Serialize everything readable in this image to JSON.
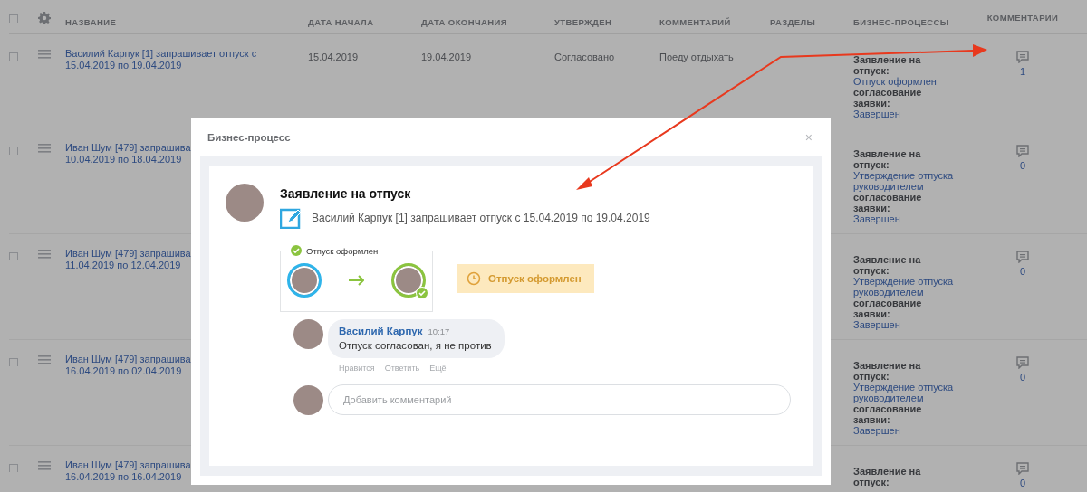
{
  "table": {
    "header_checkbox": {
      "checked": false
    },
    "columns": [
      "НАЗВАНИЕ",
      "ДАТА НАЧАЛА",
      "ДАТА ОКОНЧАНИЯ",
      "УТВЕРЖДЕН",
      "КОММЕНТАРИЙ",
      "РАЗДЕЛЫ",
      "БИЗНЕС-ПРОЦЕССЫ",
      "КОММЕНТАРИИ"
    ],
    "rows": [
      {
        "checked": false,
        "title_lines": [
          "Василий Карпук [1] запрашивает отпуск с",
          "15.04.2019 по 19.04.2019"
        ],
        "start_date": "15.04.2019",
        "end_date": "19.04.2019",
        "approved": "Согласовано",
        "comment": "Поеду отдыхать",
        "processes": [
          {
            "label": "Заявление на отпуск:",
            "status": "Отпуск оформлен"
          },
          {
            "label": "согласование заявки:",
            "status": "Завершен"
          }
        ],
        "comment_count": "1"
      },
      {
        "checked": false,
        "title_lines": [
          "Иван Шум [479] запрашива",
          "10.04.2019 по 18.04.2019"
        ],
        "processes": [
          {
            "label": "Заявление на отпуск:",
            "status": "Утверждение отпуска руководителем"
          },
          {
            "label": "согласование заявки:",
            "status": "Завершен"
          }
        ],
        "comment_count": "0"
      },
      {
        "checked": false,
        "title_lines": [
          "Иван Шум [479] запрашива",
          "11.04.2019 по 12.04.2019"
        ],
        "processes": [
          {
            "label": "Заявление на отпуск:",
            "status": "Утверждение отпуска руководителем"
          },
          {
            "label": "согласование заявки:",
            "status": "Завершен"
          }
        ],
        "comment_count": "0"
      },
      {
        "checked": false,
        "title_lines": [
          "Иван Шум [479] запрашива",
          "16.04.2019 по 02.04.2019"
        ],
        "processes": [
          {
            "label": "Заявление на отпуск:",
            "status": "Утверждение отпуска руководителем"
          },
          {
            "label": "согласование заявки:",
            "status": "Завершен"
          }
        ],
        "comment_count": "0"
      },
      {
        "checked": false,
        "title_lines": [
          "Иван Шум [479] запрашива",
          "16.04.2019 по 16.04.2019"
        ],
        "processes": [
          {
            "label": "Заявление на отпуск:"
          }
        ],
        "comment_count": "0"
      }
    ]
  },
  "dialog": {
    "title": "Бизнес-процесс",
    "close": "×",
    "heading": "Заявление на отпуск",
    "description": "Василий Карпук [1] запрашивает отпуск с 15.04.2019 по 19.04.2019",
    "workflow_legend": "Отпуск оформлен",
    "status_badge": "Отпуск оформлен",
    "comment": {
      "author": "Василий Карпук",
      "time": "10:17",
      "text": "Отпуск согласован, я не против",
      "actions": [
        "Нравится",
        "Ответить",
        "Ещё"
      ]
    },
    "comment_input": {
      "placeholder": "Добавить комментарий"
    }
  }
}
